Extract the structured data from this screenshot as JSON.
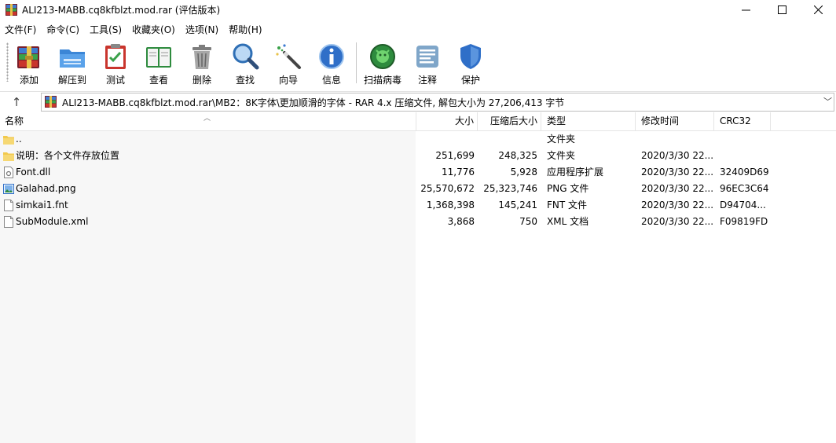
{
  "window": {
    "title": "ALI213-MABB.cq8kfblzt.mod.rar (评估版本)",
    "controls": {
      "minimize": "minimize",
      "maximize": "maximize",
      "close": "close"
    }
  },
  "menu": [
    {
      "label": "文件(F)"
    },
    {
      "label": "命令(C)"
    },
    {
      "label": "工具(S)"
    },
    {
      "label": "收藏夹(O)"
    },
    {
      "label": "选项(N)"
    },
    {
      "label": "帮助(H)"
    }
  ],
  "toolbar": [
    {
      "label": "添加",
      "icon": "add-archive-icon"
    },
    {
      "label": "解压到",
      "icon": "extract-folder-icon"
    },
    {
      "label": "测试",
      "icon": "test-clipboard-icon"
    },
    {
      "label": "查看",
      "icon": "view-book-icon"
    },
    {
      "label": "删除",
      "icon": "trash-icon"
    },
    {
      "label": "查找",
      "icon": "magnifier-icon"
    },
    {
      "label": "向导",
      "icon": "wizard-wand-icon"
    },
    {
      "label": "信息",
      "icon": "info-icon"
    },
    {
      "label": "扫描病毒",
      "icon": "virus-scan-icon"
    },
    {
      "label": "注释",
      "icon": "comment-icon"
    },
    {
      "label": "保护",
      "icon": "shield-icon"
    }
  ],
  "address": {
    "path": "ALI213-MABB.cq8kfblzt.mod.rar\\MB2：8K字体\\更加顺滑的字体 - RAR 4.x 压缩文件, 解包大小为 27,206,413 字节"
  },
  "columns": {
    "name": "名称",
    "size": "大小",
    "packed": "压缩后大小",
    "type": "类型",
    "modified": "修改时间",
    "crc": "CRC32"
  },
  "files": [
    {
      "name": "..",
      "size": "",
      "packed": "",
      "type": "文件夹",
      "modified": "",
      "crc": "",
      "icon": "folder"
    },
    {
      "name": "说明：各个文件存放位置",
      "size": "251,699",
      "packed": "248,325",
      "type": "文件夹",
      "modified": "2020/3/30 22...",
      "crc": "",
      "icon": "folder"
    },
    {
      "name": "Font.dll",
      "size": "11,776",
      "packed": "5,928",
      "type": "应用程序扩展",
      "modified": "2020/3/30 22...",
      "crc": "32409D69",
      "icon": "dll"
    },
    {
      "name": "Galahad.png",
      "size": "25,570,672",
      "packed": "25,323,746",
      "type": "PNG 文件",
      "modified": "2020/3/30 22...",
      "crc": "96EC3C64",
      "icon": "image"
    },
    {
      "name": "simkai1.fnt",
      "size": "1,368,398",
      "packed": "145,241",
      "type": "FNT 文件",
      "modified": "2020/3/30 22...",
      "crc": "D94704...",
      "icon": "file"
    },
    {
      "name": "SubModule.xml",
      "size": "3,868",
      "packed": "750",
      "type": "XML 文档",
      "modified": "2020/3/30 22...",
      "crc": "F09819FD",
      "icon": "file"
    }
  ]
}
